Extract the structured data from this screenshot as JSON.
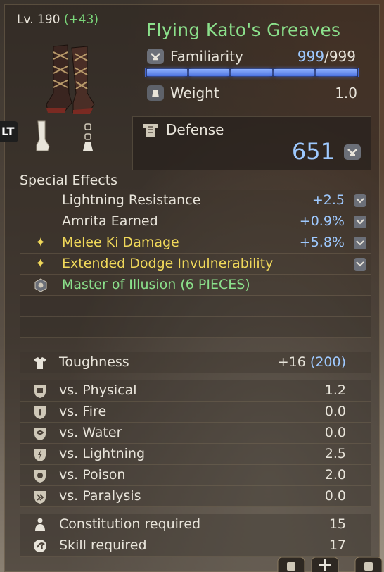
{
  "header": {
    "level_label": "Lv. 190",
    "level_bonus": "(+43)",
    "item_name": "Flying Kato's Greaves"
  },
  "familiarity": {
    "label": "Familiarity",
    "current": "999",
    "max": "/999",
    "fill": 1.0
  },
  "weight": {
    "label": "Weight",
    "value": "1.0"
  },
  "defense": {
    "label": "Defense",
    "value": "651"
  },
  "badges": {
    "lt": "LT"
  },
  "special_effects": {
    "title": "Special Effects",
    "items": [
      {
        "name": "Lightning Resistance",
        "value": "+2.5",
        "style": "white",
        "marker": ""
      },
      {
        "name": "Amrita Earned",
        "value": "+0.9%",
        "style": "white",
        "marker": ""
      },
      {
        "name": "Melee Ki Damage",
        "value": "+5.8%",
        "style": "gold",
        "marker": "✦"
      },
      {
        "name": "Extended Dodge Invulnerability",
        "value": "",
        "style": "gold",
        "marker": "✦"
      },
      {
        "name": "Master of Illusion (6 PIECES)",
        "value": "",
        "style": "green",
        "marker": "set"
      }
    ]
  },
  "toughness": {
    "label": "Toughness",
    "value": "+16",
    "base": "(200)"
  },
  "resistances": [
    {
      "label": "vs. Physical",
      "value": "1.2",
      "icon": "physical-icon"
    },
    {
      "label": "vs. Fire",
      "value": "0.0",
      "icon": "fire-icon"
    },
    {
      "label": "vs. Water",
      "value": "0.0",
      "icon": "water-icon"
    },
    {
      "label": "vs. Lightning",
      "value": "2.5",
      "icon": "lightning-icon"
    },
    {
      "label": "vs. Poison",
      "value": "2.0",
      "icon": "poison-icon"
    },
    {
      "label": "vs. Paralysis",
      "value": "0.0",
      "icon": "paralysis-icon"
    }
  ],
  "requirements": [
    {
      "label": "Constitution required",
      "value": "15",
      "icon": "constitution-icon"
    },
    {
      "label": "Skill required",
      "value": "17",
      "icon": "skill-icon"
    }
  ],
  "colors": {
    "green": "#8be08b",
    "gold": "#f0d85a",
    "blue": "#9ec9ff"
  }
}
